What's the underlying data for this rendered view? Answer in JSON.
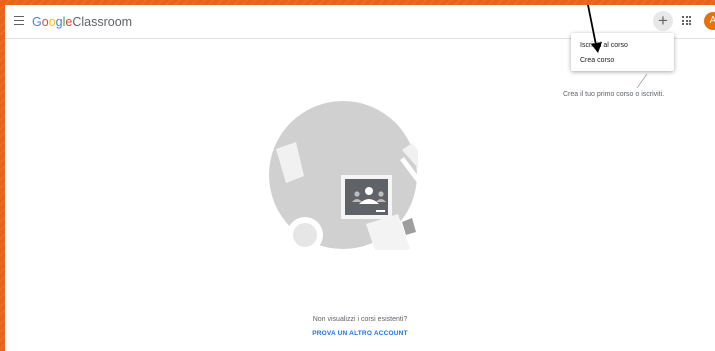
{
  "header": {
    "brand_google_letters": [
      "G",
      "o",
      "o",
      "g",
      "l",
      "e"
    ],
    "brand_product": "Classroom",
    "add_button_label": "+",
    "avatar_initial": "A"
  },
  "menu": {
    "items": [
      {
        "label": "Iscriviti al corso"
      },
      {
        "label": "Crea corso"
      }
    ]
  },
  "main": {
    "empty_hint": "Crea il tuo primo corso o iscriviti.",
    "no_courses_question": "Non visualizzi i corsi esistenti?",
    "switch_account_link": "PROVA UN ALTRO ACCOUNT"
  },
  "colors": {
    "page_border": "#e8621b",
    "link": "#1a73e8",
    "avatar": "#e8710a"
  }
}
